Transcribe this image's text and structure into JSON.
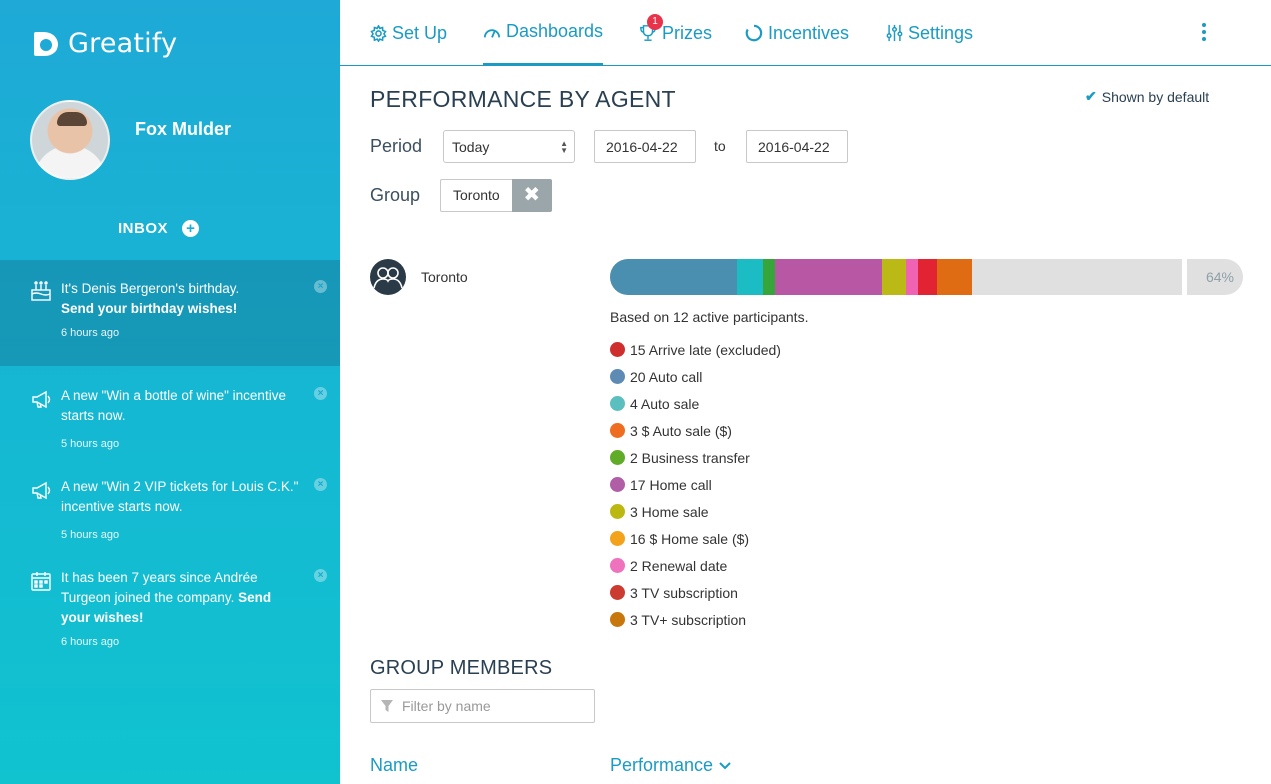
{
  "app": {
    "name": "Greatify"
  },
  "user": {
    "name": "Fox Mulder"
  },
  "inbox": {
    "label": "INBOX"
  },
  "notifications": [
    {
      "icon": "birthday-cake-icon",
      "text_plain": "It's Denis Bergeron's birthday.",
      "text_bold": "Send your birthday wishes!",
      "time": "6 hours ago",
      "active": true
    },
    {
      "icon": "megaphone-icon",
      "text_plain": "A new \"Win a bottle of wine\" incentive starts now.",
      "text_bold": "",
      "time": "5 hours ago"
    },
    {
      "icon": "megaphone-icon",
      "text_plain": "A new \"Win 2 VIP tickets for Louis C.K.\" incentive starts now.",
      "text_bold": "",
      "time": "5 hours ago"
    },
    {
      "icon": "calendar-icon",
      "text_plain": "It has been 7 years since Andrée Turgeon joined the company.",
      "text_bold": "Send your wishes!",
      "time": "6 hours ago"
    }
  ],
  "nav": {
    "items": [
      {
        "label": "Set Up",
        "icon": "gear-icon"
      },
      {
        "label": "Dashboards",
        "icon": "gauge-icon",
        "active": true
      },
      {
        "label": "Prizes",
        "icon": "trophy-icon",
        "badge": "1"
      },
      {
        "label": "Incentives",
        "icon": "spinner-icon"
      },
      {
        "label": "Settings",
        "icon": "sliders-icon"
      }
    ]
  },
  "page": {
    "title": "PERFORMANCE BY AGENT",
    "shown_default": "Shown by default",
    "period_label": "Period",
    "period_value": "Today",
    "date_from": "2016-04-22",
    "to_label": "to",
    "date_to": "2016-04-22",
    "group_label": "Group",
    "group_value": "Toronto"
  },
  "performance": {
    "team": "Toronto",
    "percent_label": "64%",
    "percent": 64,
    "note": "Based on 12 active participants.",
    "segments": [
      {
        "color": "#4a8fb0",
        "share": 0.2225
      },
      {
        "color": "#1cbcc4",
        "share": 0.0445
      },
      {
        "color": "#36a53a",
        "share": 0.0207
      },
      {
        "color": "#b858a4",
        "share": 0.1885
      },
      {
        "color": "#bbb915",
        "share": 0.0418
      },
      {
        "color": "#f063b3",
        "share": 0.0209
      },
      {
        "color": "#e22331",
        "share": 0.033
      },
      {
        "color": "#df6b12",
        "share": 0.061
      }
    ],
    "legend": [
      {
        "label": "15 Arrive late (excluded)",
        "color": "#cf2e2e"
      },
      {
        "label": "20 Auto call",
        "color": "#5d8bb3"
      },
      {
        "label": "4 Auto sale",
        "color": "#5bbfc0"
      },
      {
        "label": "3 $ Auto sale ($)",
        "color": "#ef6d20"
      },
      {
        "label": "2 Business transfer",
        "color": "#60ab28"
      },
      {
        "label": "17 Home call",
        "color": "#b05ea5"
      },
      {
        "label": "3 Home sale",
        "color": "#bcb812"
      },
      {
        "label": "16 $ Home sale ($)",
        "color": "#f2a21b"
      },
      {
        "label": "2 Renewal date",
        "color": "#ef72bd"
      },
      {
        "label": "3 TV subscription",
        "color": "#cb3b30"
      },
      {
        "label": "3 TV+ subscription",
        "color": "#c7770c"
      }
    ]
  },
  "members": {
    "title": "GROUP MEMBERS",
    "filter_placeholder": "Filter by name",
    "col_name": "Name",
    "col_performance": "Performance"
  }
}
